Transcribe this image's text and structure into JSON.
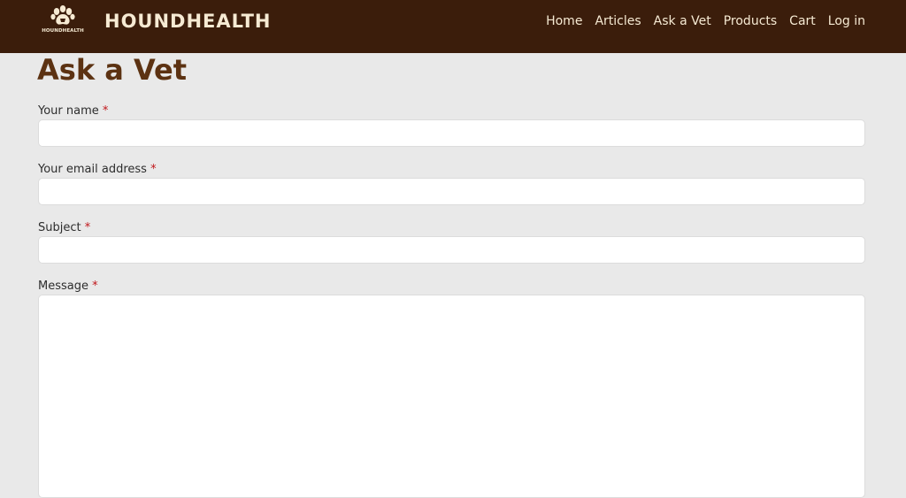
{
  "header": {
    "logo_text": "HOUNDHEALTH",
    "brand": "HOUNDHEALTH",
    "nav": [
      {
        "label": "Home"
      },
      {
        "label": "Articles"
      },
      {
        "label": "Ask a Vet"
      },
      {
        "label": "Products"
      },
      {
        "label": "Cart"
      },
      {
        "label": "Log in"
      }
    ]
  },
  "page": {
    "title": "Ask a Vet"
  },
  "form": {
    "required_mark": "*",
    "name_label": "Your name",
    "name_value": "",
    "email_label": "Your email address",
    "email_value": "",
    "subject_label": "Subject",
    "subject_value": "",
    "message_label": "Message",
    "message_value": ""
  },
  "colors": {
    "header_bg": "#3b1d0b",
    "header_text": "#f6ead3",
    "title": "#5c3212",
    "page_bg": "#e9e9e9",
    "required": "#c0161a"
  },
  "icons": {
    "logo": "paw-icon"
  }
}
